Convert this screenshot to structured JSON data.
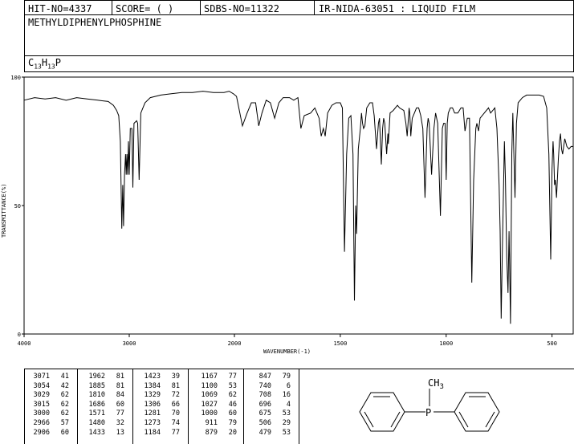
{
  "header": {
    "hit_no": "HIT-NO=4337",
    "score": "SCORE=  (   )",
    "sdbs_no": "SDBS-NO=11322",
    "method": "IR-NIDA-63051 : LIQUID FILM"
  },
  "compound": {
    "name": "METHYLDIPHENYLPHOSPHINE",
    "formula": "C13H13P",
    "formula_parts": {
      "c": "C",
      "c_sub": "13",
      "h": "H",
      "h_sub": "13",
      "p": "P"
    }
  },
  "structure": {
    "substituent": "CH",
    "substituent_sub": "3",
    "center_atom": "P"
  },
  "chart_data": {
    "type": "line",
    "xlabel": "WAVENUMBER(-1)",
    "ylabel": "TRANSMITTANCE(%)",
    "xlim": [
      4000,
      400
    ],
    "ylim": [
      0,
      100
    ],
    "x_ticks": [
      "4000",
      "3000",
      "2000",
      "1500",
      "1000",
      "500"
    ],
    "y_ticks": [
      "100",
      "50",
      "0"
    ],
    "grid": false,
    "series": [
      {
        "points": [
          [
            4000,
            91
          ],
          [
            3900,
            92
          ],
          [
            3800,
            91.5
          ],
          [
            3700,
            92
          ],
          [
            3600,
            91
          ],
          [
            3500,
            92
          ],
          [
            3400,
            91.5
          ],
          [
            3300,
            91
          ],
          [
            3200,
            90.5
          ],
          [
            3150,
            89
          ],
          [
            3120,
            87
          ],
          [
            3100,
            85
          ],
          [
            3085,
            75
          ],
          [
            3071,
            41
          ],
          [
            3062,
            58
          ],
          [
            3054,
            42
          ],
          [
            3045,
            62
          ],
          [
            3035,
            70
          ],
          [
            3029,
            62
          ],
          [
            3022,
            70
          ],
          [
            3015,
            62
          ],
          [
            3008,
            75
          ],
          [
            3000,
            62
          ],
          [
            2990,
            80
          ],
          [
            2975,
            80
          ],
          [
            2966,
            57
          ],
          [
            2955,
            82
          ],
          [
            2930,
            83
          ],
          [
            2920,
            82
          ],
          [
            2906,
            60
          ],
          [
            2890,
            86
          ],
          [
            2870,
            88
          ],
          [
            2850,
            90
          ],
          [
            2800,
            92
          ],
          [
            2700,
            93
          ],
          [
            2600,
            93.5
          ],
          [
            2500,
            94
          ],
          [
            2400,
            94
          ],
          [
            2300,
            94.5
          ],
          [
            2200,
            94
          ],
          [
            2100,
            94
          ],
          [
            2050,
            94.5
          ],
          [
            2010,
            93.5
          ],
          [
            1990,
            92.5
          ],
          [
            1962,
            81
          ],
          [
            1940,
            86
          ],
          [
            1920,
            90
          ],
          [
            1900,
            90
          ],
          [
            1885,
            81
          ],
          [
            1870,
            86
          ],
          [
            1850,
            91
          ],
          [
            1830,
            90
          ],
          [
            1810,
            84
          ],
          [
            1790,
            90
          ],
          [
            1770,
            92
          ],
          [
            1740,
            92
          ],
          [
            1720,
            91
          ],
          [
            1700,
            92
          ],
          [
            1686,
            80
          ],
          [
            1670,
            85
          ],
          [
            1640,
            86
          ],
          [
            1620,
            88
          ],
          [
            1600,
            84
          ],
          [
            1590,
            77
          ],
          [
            1580,
            80
          ],
          [
            1571,
            77
          ],
          [
            1560,
            86
          ],
          [
            1540,
            89
          ],
          [
            1520,
            90
          ],
          [
            1500,
            90
          ],
          [
            1490,
            88
          ],
          [
            1480,
            32
          ],
          [
            1470,
            70
          ],
          [
            1460,
            84
          ],
          [
            1450,
            85
          ],
          [
            1440,
            70
          ],
          [
            1433,
            13
          ],
          [
            1427,
            50
          ],
          [
            1423,
            39
          ],
          [
            1415,
            72
          ],
          [
            1405,
            80
          ],
          [
            1400,
            86
          ],
          [
            1395,
            82
          ],
          [
            1390,
            80
          ],
          [
            1384,
            81
          ],
          [
            1375,
            88
          ],
          [
            1360,
            90
          ],
          [
            1348,
            90
          ],
          [
            1340,
            85
          ],
          [
            1329,
            72
          ],
          [
            1320,
            82
          ],
          [
            1315,
            84
          ],
          [
            1306,
            66
          ],
          [
            1300,
            80
          ],
          [
            1295,
            84
          ],
          [
            1290,
            82
          ],
          [
            1281,
            70
          ],
          [
            1275,
            78
          ],
          [
            1273,
            74
          ],
          [
            1265,
            86
          ],
          [
            1250,
            87
          ],
          [
            1230,
            89
          ],
          [
            1220,
            88
          ],
          [
            1200,
            87
          ],
          [
            1190,
            82
          ],
          [
            1184,
            77
          ],
          [
            1175,
            88
          ],
          [
            1172,
            86
          ],
          [
            1167,
            77
          ],
          [
            1160,
            84
          ],
          [
            1150,
            86
          ],
          [
            1140,
            88
          ],
          [
            1130,
            88
          ],
          [
            1120,
            85
          ],
          [
            1110,
            80
          ],
          [
            1100,
            53
          ],
          [
            1090,
            80
          ],
          [
            1085,
            84
          ],
          [
            1080,
            82
          ],
          [
            1069,
            62
          ],
          [
            1058,
            80
          ],
          [
            1050,
            86
          ],
          [
            1040,
            82
          ],
          [
            1027,
            46
          ],
          [
            1018,
            80
          ],
          [
            1012,
            82
          ],
          [
            1005,
            82
          ],
          [
            1000,
            60
          ],
          [
            995,
            82
          ],
          [
            990,
            86
          ],
          [
            980,
            88
          ],
          [
            970,
            88
          ],
          [
            960,
            86
          ],
          [
            945,
            86
          ],
          [
            930,
            88
          ],
          [
            920,
            88
          ],
          [
            911,
            79
          ],
          [
            900,
            84
          ],
          [
            890,
            84
          ],
          [
            879,
            20
          ],
          [
            870,
            60
          ],
          [
            860,
            80
          ],
          [
            855,
            82
          ],
          [
            847,
            79
          ],
          [
            840,
            84
          ],
          [
            820,
            86
          ],
          [
            800,
            88
          ],
          [
            790,
            86
          ],
          [
            780,
            87
          ],
          [
            770,
            88
          ],
          [
            760,
            80
          ],
          [
            750,
            58
          ],
          [
            745,
            40
          ],
          [
            740,
            6
          ],
          [
            735,
            30
          ],
          [
            725,
            75
          ],
          [
            720,
            60
          ],
          [
            714,
            30
          ],
          [
            708,
            16
          ],
          [
            703,
            40
          ],
          [
            700,
            25
          ],
          [
            696,
            4
          ],
          [
            690,
            70
          ],
          [
            685,
            86
          ],
          [
            675,
            53
          ],
          [
            668,
            82
          ],
          [
            660,
            90
          ],
          [
            640,
            92
          ],
          [
            620,
            93
          ],
          [
            600,
            93
          ],
          [
            580,
            93
          ],
          [
            560,
            93
          ],
          [
            540,
            92.5
          ],
          [
            525,
            88
          ],
          [
            515,
            70
          ],
          [
            506,
            29
          ],
          [
            500,
            64
          ],
          [
            495,
            75
          ],
          [
            492,
            70
          ],
          [
            488,
            58
          ],
          [
            484,
            60
          ],
          [
            479,
            53
          ],
          [
            470,
            68
          ],
          [
            465,
            75
          ],
          [
            460,
            78
          ],
          [
            455,
            72
          ],
          [
            450,
            70
          ],
          [
            440,
            76
          ],
          [
            430,
            73
          ],
          [
            420,
            72
          ],
          [
            410,
            73
          ],
          [
            400,
            73
          ]
        ]
      }
    ],
    "peak_table": [
      [
        [
          "3071",
          "41"
        ],
        [
          "3054",
          "42"
        ],
        [
          "3029",
          "62"
        ],
        [
          "3015",
          "62"
        ],
        [
          "3000",
          "62"
        ],
        [
          "2966",
          "57"
        ],
        [
          "2906",
          "60"
        ]
      ],
      [
        [
          "1962",
          "81"
        ],
        [
          "1885",
          "81"
        ],
        [
          "1810",
          "84"
        ],
        [
          "1686",
          "60"
        ],
        [
          "1571",
          "77"
        ],
        [
          "1480",
          "32"
        ],
        [
          "1433",
          "13"
        ]
      ],
      [
        [
          "1423",
          "39"
        ],
        [
          "1384",
          "81"
        ],
        [
          "1329",
          "72"
        ],
        [
          "1306",
          "66"
        ],
        [
          "1281",
          "70"
        ],
        [
          "1273",
          "74"
        ],
        [
          "1184",
          "77"
        ]
      ],
      [
        [
          "1167",
          "77"
        ],
        [
          "1100",
          "53"
        ],
        [
          "1069",
          "62"
        ],
        [
          "1027",
          "46"
        ],
        [
          "1000",
          "60"
        ],
        [
          "911",
          "79"
        ],
        [
          "879",
          "20"
        ]
      ],
      [
        [
          "847",
          "79"
        ],
        [
          "740",
          "6"
        ],
        [
          "708",
          "16"
        ],
        [
          "696",
          "4"
        ],
        [
          "675",
          "53"
        ],
        [
          "506",
          "29"
        ],
        [
          "479",
          "53"
        ]
      ]
    ]
  }
}
